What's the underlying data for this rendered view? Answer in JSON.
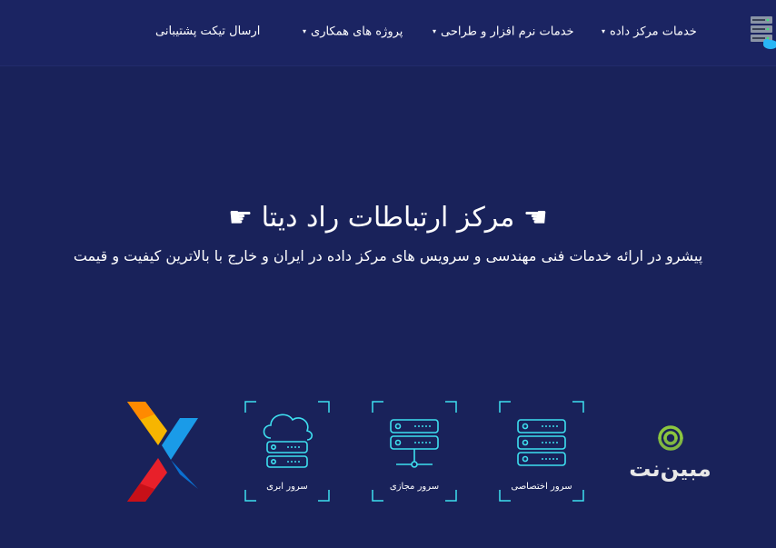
{
  "header": {
    "logo_icon": "server-rack-cloud-icon",
    "nav": [
      {
        "label": "خدمات مرکز داده",
        "has_dropdown": true
      },
      {
        "label": "خدمات نرم افزار و طراحی",
        "has_dropdown": true
      },
      {
        "label": "پروژه های همکاری",
        "has_dropdown": true
      },
      {
        "label": "ارسال تیکت پشتیبانی",
        "has_dropdown": false
      }
    ],
    "caret_icon": "▾"
  },
  "hero": {
    "title": "☚ مرکز ارتباطات راد دیتا ☛",
    "subtitle": "پیشرو در ارائه خدمات فنی مهندسی و سرویس های مرکز داده در ایران و خارج با بالاترین کیفیت و قیمت"
  },
  "services": [
    {
      "label": "سرور اختصاصی",
      "icon": "dedicated-server-icon"
    },
    {
      "label": "سرور مجازی",
      "icon": "virtual-server-icon"
    },
    {
      "label": "سرور ابری",
      "icon": "cloud-server-icon"
    }
  ],
  "partners": {
    "mobinnet_text": "مبین‌نت",
    "mobinnet_icon": "mobinnet-logo-icon",
    "x_icon": "x-brand-logo-icon"
  },
  "colors": {
    "background": "#19225a",
    "navbar": "#1b2462",
    "accent": "#3ee0f0",
    "mobinnet_green": "#8cc63f"
  }
}
